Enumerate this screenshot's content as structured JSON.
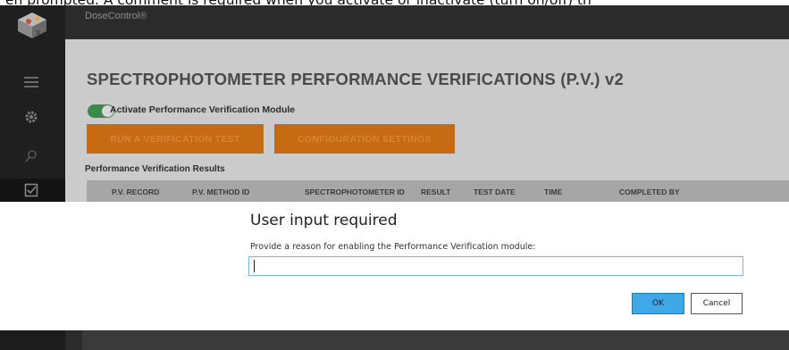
{
  "caption": {
    "text": "en prompted. A comment is required when you activate or inactivate (turn on/off) th"
  },
  "app": {
    "brand": "DoseControl®"
  },
  "sidebar": {
    "icons": [
      "menu-icon",
      "settings-icon",
      "search-icon",
      "checkbox-icon"
    ]
  },
  "page": {
    "title": "SPECTROPHOTOMETER PERFORMANCE VERIFICATIONS (P.V.) v2",
    "toggle_label": "Activate Performance Verification Module",
    "toggle_on": true,
    "buttons": {
      "run_test": "RUN A VERIFICATION TEST",
      "config": "CONFIGURATION SETTINGS"
    },
    "results_label": "Performance Verification Results",
    "table_headers": [
      "P.V. RECORD",
      "P.V. METHOD ID",
      "SPECTROPHOTOMETER ID",
      "RESULT",
      "TEST DATE",
      "TIME",
      "COMPLETED BY"
    ]
  },
  "modal": {
    "title": "User input required",
    "prompt": "Provide a reason for enabling the Performance Verification module:",
    "input_value": "",
    "ok_label": "OK",
    "cancel_label": "Cancel"
  },
  "colors": {
    "accent_orange": "#c66a13",
    "toggle_green": "#3a8a4d",
    "ok_blue": "#3fa8e6",
    "sidebar_dark": "#1f1f1f"
  }
}
